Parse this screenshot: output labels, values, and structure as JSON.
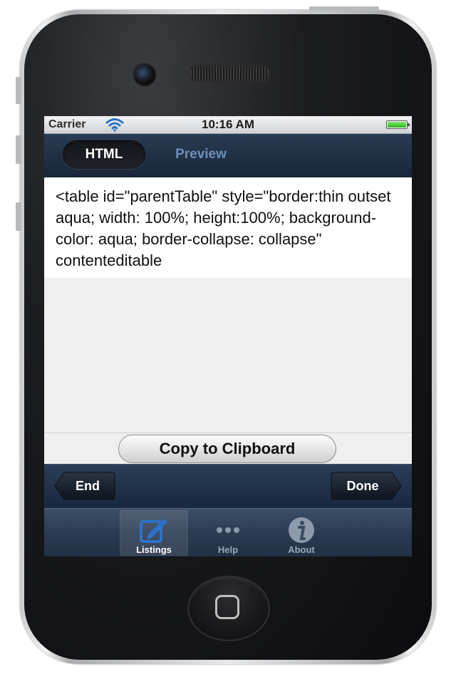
{
  "status_bar": {
    "carrier": "Carrier",
    "time": "10:16 AM",
    "icons": [
      "wifi-icon",
      "battery-icon"
    ]
  },
  "nav": {
    "segments": [
      {
        "label": "HTML",
        "selected": true
      },
      {
        "label": "Preview",
        "selected": false
      }
    ]
  },
  "html_text": "<table id=\"parentTable\" style=\"border:thin outset aqua; width: 100%; height:100%; background-color: aqua; border-collapse: collapse\" contenteditable",
  "copy_button_label": "Copy to Clipboard",
  "toolbar": {
    "end_label": "End",
    "done_label": "Done"
  },
  "tabs": [
    {
      "label": "Listings",
      "icon": "compose-icon",
      "selected": true
    },
    {
      "label": "Help",
      "icon": "ellipsis-icon",
      "selected": false
    },
    {
      "label": "About",
      "icon": "info-icon",
      "selected": false
    }
  ],
  "colors": {
    "nav_background": "#1f2f45",
    "accent_blue": "#2d6ab4",
    "battery_green": "#3bbf2a"
  }
}
